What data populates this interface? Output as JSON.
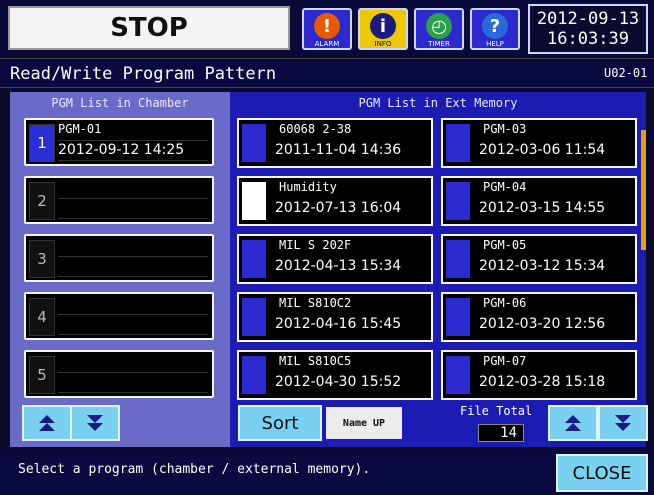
{
  "header": {
    "status_label": "STOP",
    "buttons": [
      {
        "label": "ALARM",
        "icon": "alarm-icon",
        "color": "#e85a00"
      },
      {
        "label": "INFO",
        "icon": "info-icon",
        "color": "#f0c800"
      },
      {
        "label": "TIMER",
        "icon": "timer-icon",
        "color": "#2aa04a"
      },
      {
        "label": "HELP",
        "icon": "help-icon",
        "color": "#2a6ad8"
      }
    ],
    "date": "2012-09-13",
    "time": "16:03:39"
  },
  "title": "Read/Write Program Pattern",
  "screen_id": "U02-01",
  "chamber": {
    "heading": "PGM List in Chamber",
    "slots": [
      {
        "num": "1",
        "name": "PGM-01",
        "date": "2012-09-12 14:25",
        "active": true
      },
      {
        "num": "2",
        "name": "",
        "date": ""
      },
      {
        "num": "3",
        "name": "",
        "date": ""
      },
      {
        "num": "4",
        "name": "",
        "date": ""
      },
      {
        "num": "5",
        "name": "",
        "date": ""
      }
    ]
  },
  "external": {
    "heading": "PGM List in Ext Memory",
    "items": [
      {
        "name": "60068 2-38",
        "date": "2011-11-04 14:36"
      },
      {
        "name": "PGM-03",
        "date": "2012-03-06 11:54"
      },
      {
        "name": "Humidity",
        "date": "2012-07-13 16:04"
      },
      {
        "name": "PGM-04",
        "date": "2012-03-15 14:55"
      },
      {
        "name": "MIL S 202F",
        "date": "2012-04-13 15:34"
      },
      {
        "name": "PGM-05",
        "date": "2012-03-12 15:34"
      },
      {
        "name": "MIL S810C2",
        "date": "2012-04-16 15:45"
      },
      {
        "name": "PGM-06",
        "date": "2012-03-20 12:56"
      },
      {
        "name": "MIL S810C5",
        "date": "2012-04-30 15:52"
      },
      {
        "name": "PGM-07",
        "date": "2012-03-28 15:18"
      }
    ],
    "sort_label": "Sort",
    "sort_mode": "Name UP",
    "file_total_label": "File Total",
    "file_total": "14"
  },
  "status_message": "Select a program (chamber / external memory).",
  "close_label": "CLOSE"
}
